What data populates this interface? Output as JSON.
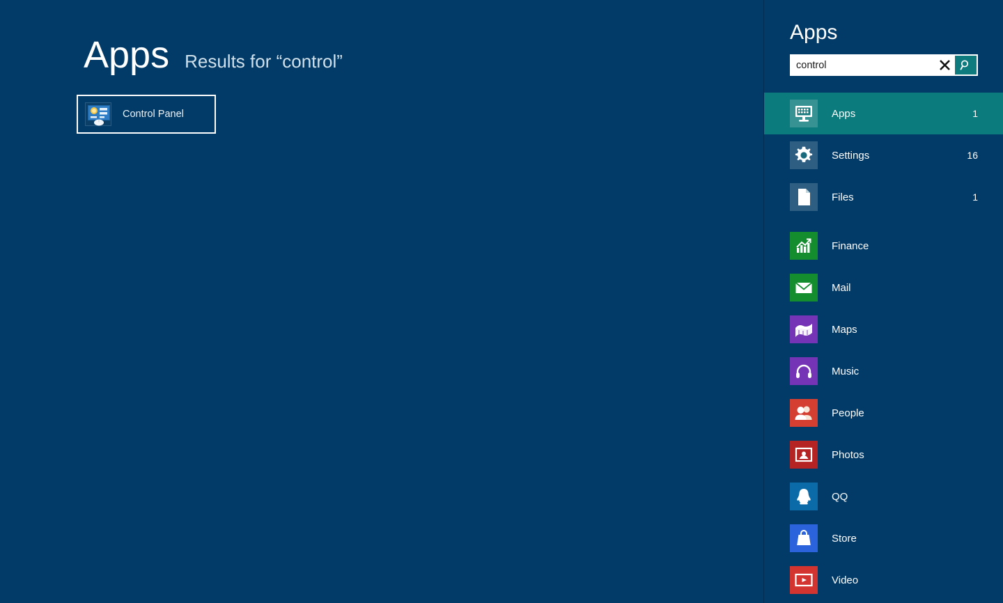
{
  "main": {
    "title": "Apps",
    "subtitle": "Results for “control”",
    "result_tile": {
      "label": "Control Panel",
      "icon": "control-panel-icon",
      "selected": true
    }
  },
  "panel": {
    "title": "Apps",
    "search": {
      "value": "control",
      "placeholder": "Search",
      "clear_icon": "close-icon",
      "submit_icon": "search-icon"
    },
    "scopes": [
      {
        "label": "Apps",
        "count": "1",
        "icon": "apps-icon",
        "tile": "tile-sys",
        "selected": true
      },
      {
        "label": "Settings",
        "count": "16",
        "icon": "gear-icon",
        "tile": "tile-sys",
        "selected": false
      },
      {
        "label": "Files",
        "count": "1",
        "icon": "file-icon",
        "tile": "tile-sys",
        "selected": false
      }
    ],
    "apps": [
      {
        "label": "Finance",
        "count": "",
        "icon": "finance-icon",
        "tile": "tile-green"
      },
      {
        "label": "Mail",
        "count": "",
        "icon": "mail-icon",
        "tile": "tile-green"
      },
      {
        "label": "Maps",
        "count": "",
        "icon": "maps-icon",
        "tile": "tile-purple"
      },
      {
        "label": "Music",
        "count": "",
        "icon": "music-icon",
        "tile": "tile-purple"
      },
      {
        "label": "People",
        "count": "",
        "icon": "people-icon",
        "tile": "tile-red"
      },
      {
        "label": "Photos",
        "count": "",
        "icon": "photos-icon",
        "tile": "tile-darkred"
      },
      {
        "label": "QQ",
        "count": "",
        "icon": "qq-icon",
        "tile": "tile-blue"
      },
      {
        "label": "Store",
        "count": "",
        "icon": "store-icon",
        "tile": "tile-brightblue"
      },
      {
        "label": "Video",
        "count": "",
        "icon": "video-icon",
        "tile": "tile-videored"
      }
    ]
  },
  "colors": {
    "background": "#023b68",
    "accent_teal": "#0b7b7d",
    "search_button": "#0e7b7f",
    "text": "#ffffff",
    "subtitle_text": "#cfe0ea"
  }
}
